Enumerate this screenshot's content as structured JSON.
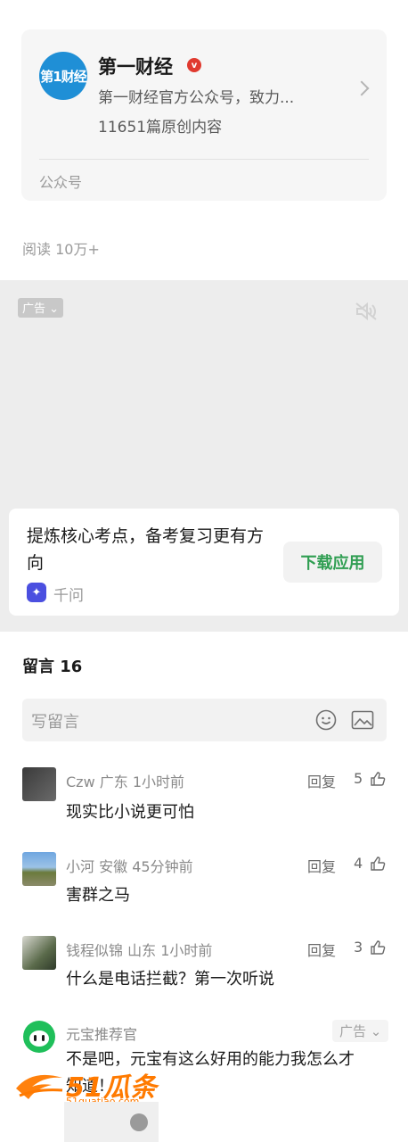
{
  "account": {
    "logo_text": "第1财经",
    "name": "第一财经",
    "verified_mark": "v",
    "description": "第一财经官方公众号，致力...",
    "original_count": "11651篇原创内容",
    "type_label": "公众号"
  },
  "read_count": "阅读 10万+",
  "ad": {
    "tag": "广告",
    "title": "提炼核心考点，备考复习更有方向",
    "app_name": "千问",
    "download_label": "下载应用"
  },
  "comments_section": {
    "title": "留言 16",
    "input_placeholder": "写留言",
    "items": [
      {
        "user": "Czw",
        "location": "广东",
        "time": "1小时前",
        "text": "现实比小说更可怕",
        "reply_label": "回复",
        "likes": "5"
      },
      {
        "user": "小河",
        "location": "安徽",
        "time": "45分钟前",
        "text": "害群之马",
        "reply_label": "回复",
        "likes": "4"
      },
      {
        "user": "钱程似锦",
        "location": "山东",
        "time": "1小时前",
        "text": "什么是电话拦截？第一次听说",
        "reply_label": "回复",
        "likes": "3"
      }
    ],
    "promoted": {
      "user": "元宝推荐官",
      "tag": "广告",
      "text_line1": "不是吧，元宝有这么好用的能力我怎么才",
      "text_line2": "知道！"
    }
  },
  "watermark": {
    "brand": "51瓜条",
    "url": "51guatiao.com"
  },
  "colors": {
    "accent_green": "#2f9e52",
    "verified_red": "#e03a2f",
    "logo_blue": "#1f8fd6",
    "watermark_orange": "#ff7a00"
  }
}
